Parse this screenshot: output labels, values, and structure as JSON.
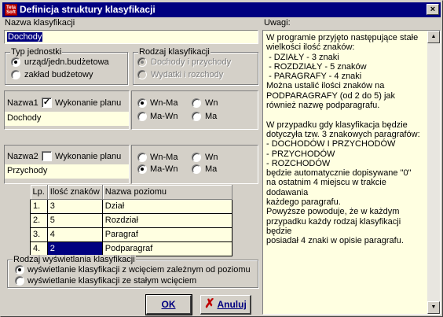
{
  "window": {
    "title": "Definicja struktury klasyfikacji",
    "icon_text": "Teta Soft",
    "close_glyph": "×"
  },
  "nazwa": {
    "label": "Nazwa klasyfikacji",
    "value": "Dochody"
  },
  "typ": {
    "title": "Typ jednostki",
    "options": [
      "urząd/jedn.budżetowa",
      "zakład budżetowy"
    ],
    "selected": 0
  },
  "rodzaj": {
    "title": "Rodzaj klasyfikacji",
    "options": [
      "Dochody i przychody",
      "Wydatki i rozchody"
    ],
    "selected": 0
  },
  "nazwa1": {
    "label": "Nazwa1",
    "check_label": "Wykonanie planu",
    "checked": true,
    "value": "Dochody",
    "options": [
      "Wn-Ma",
      "Wn",
      "Ma-Wn",
      "Ma"
    ],
    "selected": "Wn-Ma"
  },
  "nazwa2": {
    "label": "Nazwa2",
    "check_label": "Wykonanie planu",
    "checked": false,
    "value": "Przychody",
    "options": [
      "Wn-Ma",
      "Wn",
      "Ma-Wn",
      "Ma"
    ],
    "selected": "Ma-Wn"
  },
  "table": {
    "headers": [
      "Lp.",
      "Ilość znaków",
      "Nazwa poziomu"
    ],
    "rows": [
      {
        "lp": "1.",
        "znaki": "3",
        "nazwa": "Dział"
      },
      {
        "lp": "2.",
        "znaki": "5",
        "nazwa": "Rozdział"
      },
      {
        "lp": "3.",
        "znaki": "4",
        "nazwa": "Paragraf"
      },
      {
        "lp": "4.",
        "znaki": "2",
        "nazwa": "Podparagraf"
      }
    ]
  },
  "wyswietlanie": {
    "title": "Rodzaj wyświetlania klasyfikacji",
    "options": [
      "wyświetlanie klasyfikacji z wcięciem zależnym od poziomu",
      "wyświetlanie klasyfikacji ze stałym wcięciem"
    ],
    "selected": 0
  },
  "uwagi": {
    "label": "Uwagi:",
    "text": "W programie przyjęto następujące stałe\nwielkości ilość znaków:\n - DZIAŁY - 3 znaki\n - ROZDZIAŁY - 5 znaków\n - PARAGRAFY - 4 znaki\nMożna ustalić ilości znaków na\nPODPARAGRAFY (od 2 do 5) jak\nrównież nazwę podparagrafu.\n\nW przypadku gdy klasyfikacja będzie\ndotyczyła tzw. 3 znakowych paragrafów:\n- DOCHODÓW I PRZYCHODÓW\n- PRZYCHODÓW\n- ROZCHODÓW\nbędzie automatycznie dopisywane \"0\"\nna ostatnim 4 miejscu w trakcie dodawania\nkażdego paragrafu.\nPowyższe powoduje, że w każdym\nprzypadku każdy rodzaj klasyfikacji będzie\nposiadał 4 znaki w opisie paragrafu."
  },
  "buttons": {
    "ok": "OK",
    "ok_glyph": "✓",
    "cancel": "Anuluj",
    "cancel_glyph": "✗"
  },
  "colors": {
    "titlebar": "#000080",
    "field": "#ffffe1",
    "face": "#d4d0c8",
    "ok_icon": "#008000",
    "cancel_icon": "#c00000"
  }
}
